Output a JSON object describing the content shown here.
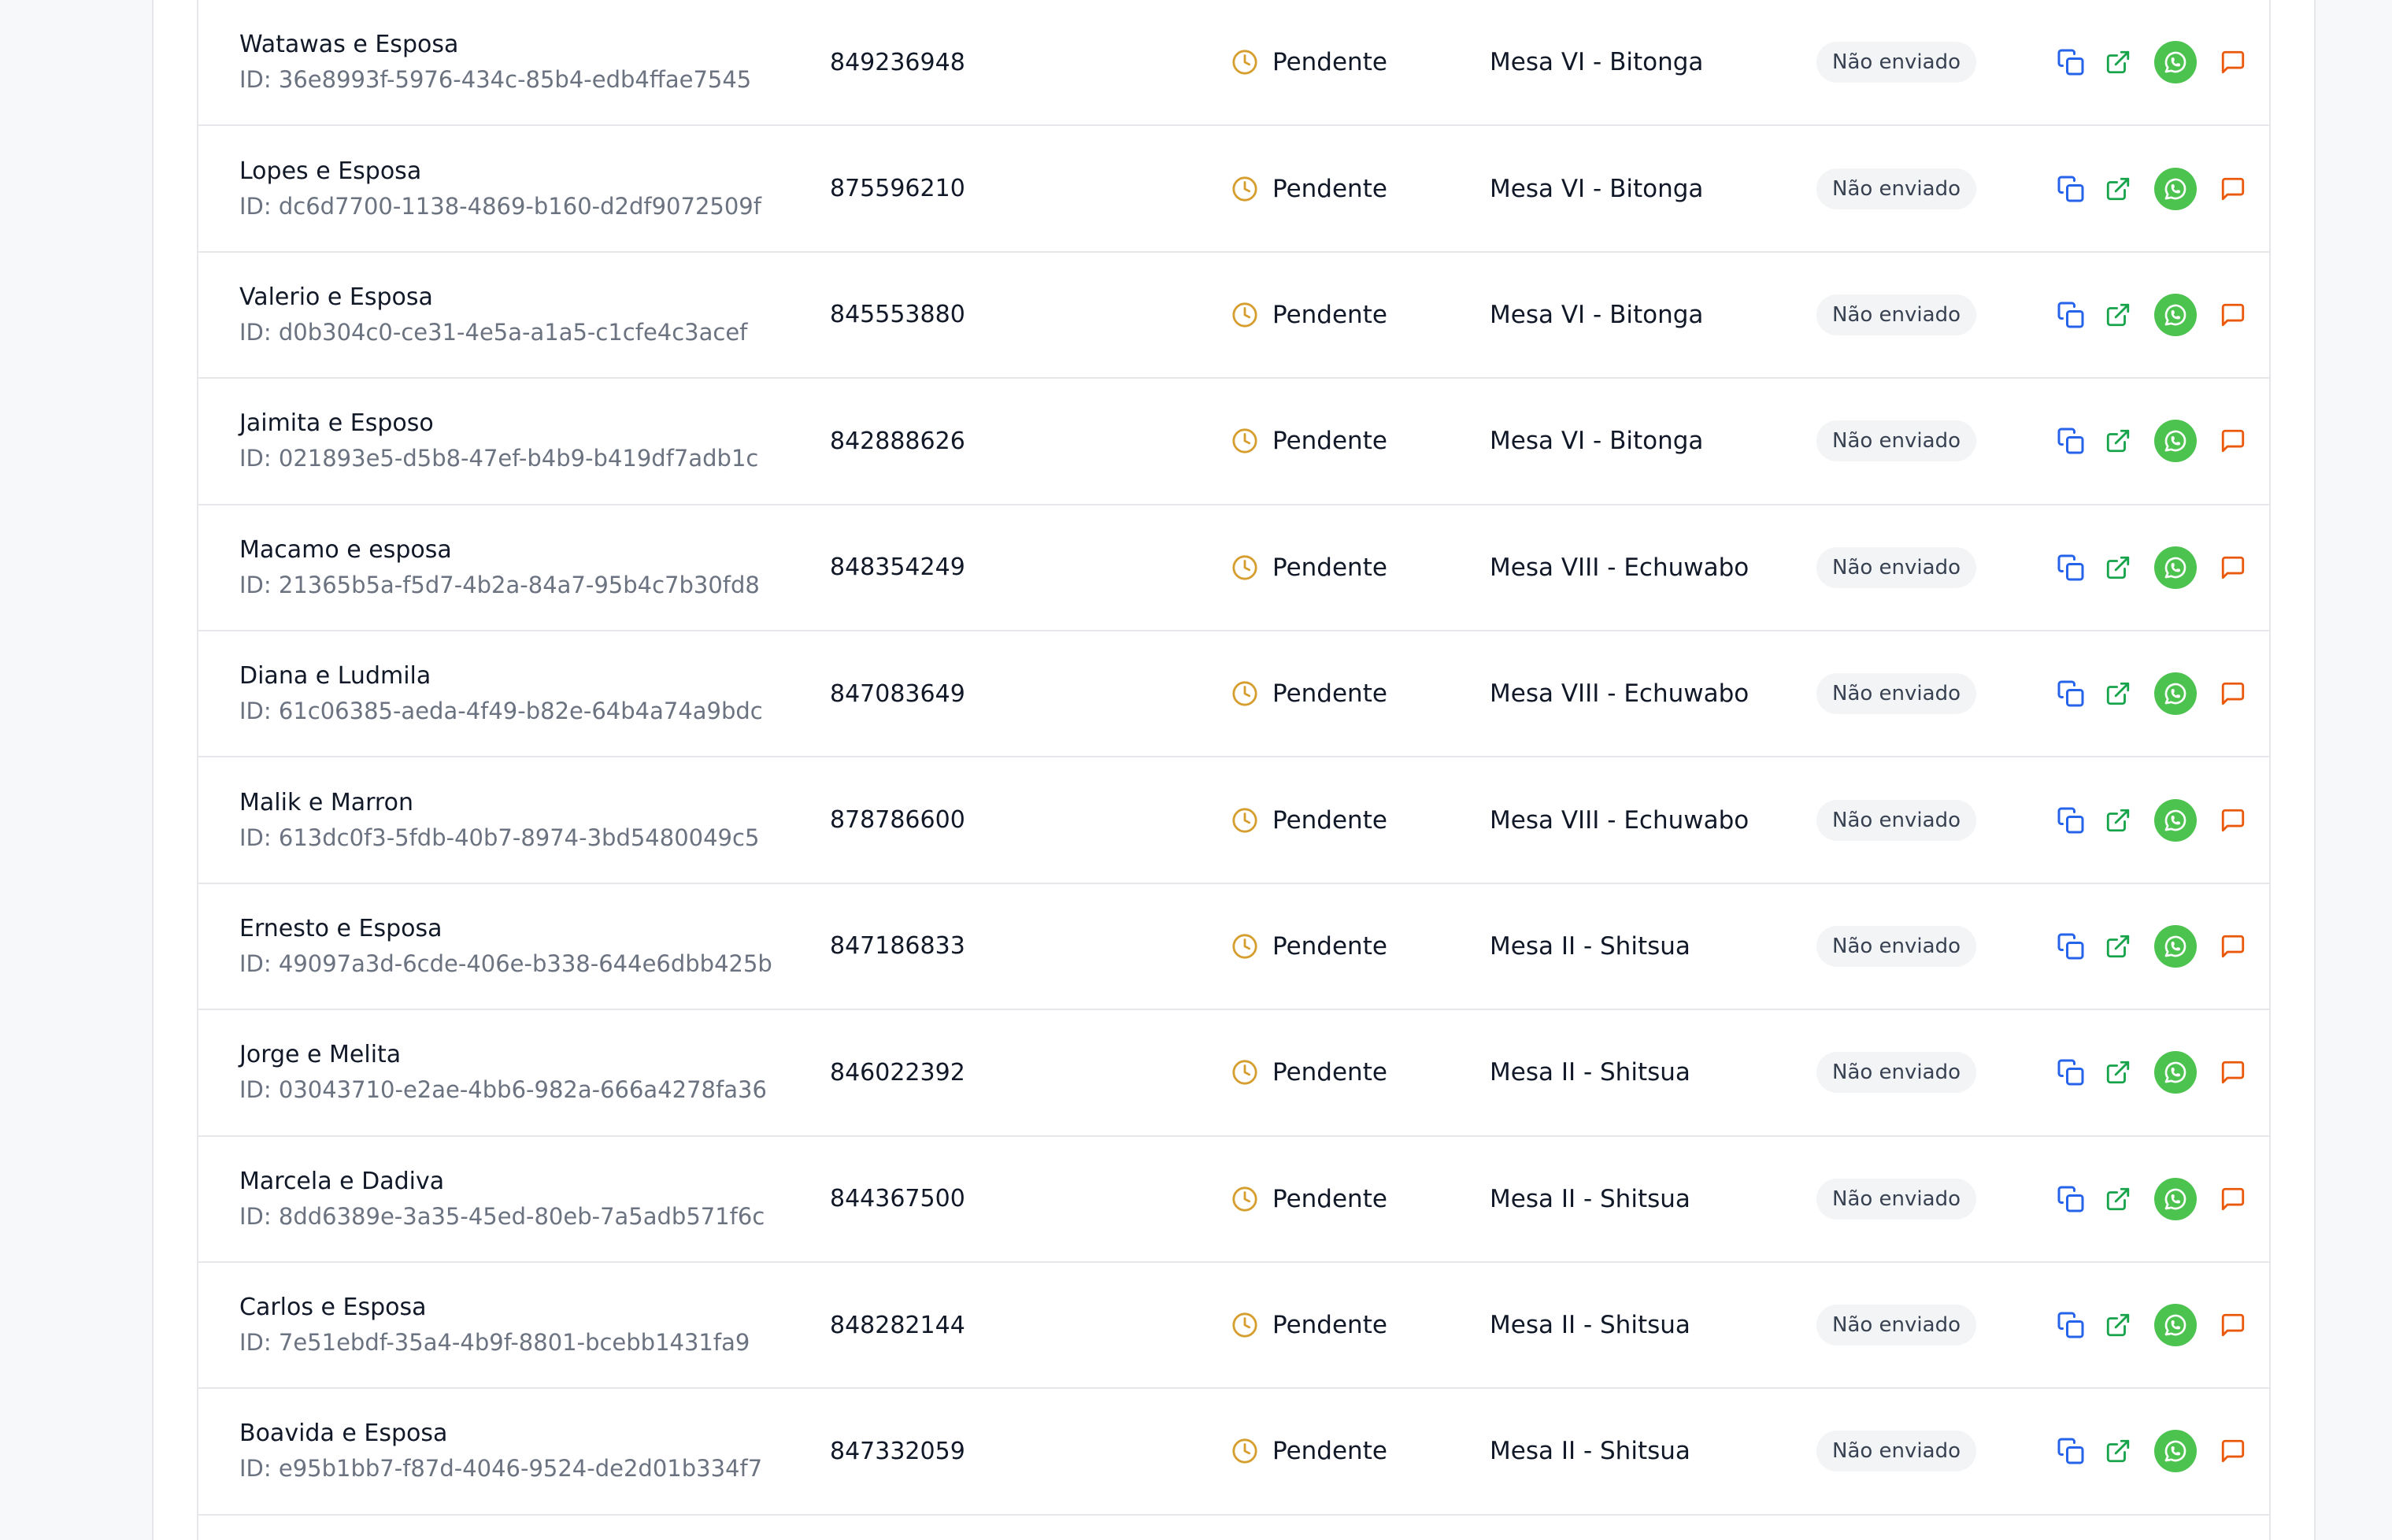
{
  "colors": {
    "status_icon": "#d69e2e",
    "copy_icon": "#2563eb",
    "open_icon": "#16a34a",
    "whatsapp_bg": "#4cc24f",
    "message_icon": "#ea580c"
  },
  "guests": [
    {
      "name": "Watawas e Esposa",
      "id": "ID: 36e8993f-5976-434c-85b4-edb4ffae7545",
      "phone": "849236948",
      "status": "Pendente",
      "table": "Mesa VI - Bitonga",
      "sent": "Não enviado"
    },
    {
      "name": "Lopes e Esposa",
      "id": "ID: dc6d7700-1138-4869-b160-d2df9072509f",
      "phone": "875596210",
      "status": "Pendente",
      "table": "Mesa VI - Bitonga",
      "sent": "Não enviado"
    },
    {
      "name": "Valerio e Esposa",
      "id": "ID: d0b304c0-ce31-4e5a-a1a5-c1cfe4c3acef",
      "phone": "845553880",
      "status": "Pendente",
      "table": "Mesa VI - Bitonga",
      "sent": "Não enviado"
    },
    {
      "name": "Jaimita e Esposo",
      "id": "ID: 021893e5-d5b8-47ef-b4b9-b419df7adb1c",
      "phone": "842888626",
      "status": "Pendente",
      "table": "Mesa VI - Bitonga",
      "sent": "Não enviado"
    },
    {
      "name": "Macamo e esposa",
      "id": "ID: 21365b5a-f5d7-4b2a-84a7-95b4c7b30fd8",
      "phone": "848354249",
      "status": "Pendente",
      "table": "Mesa VIII - Echuwabo",
      "sent": "Não enviado"
    },
    {
      "name": "Diana e Ludmila",
      "id": "ID: 61c06385-aeda-4f49-b82e-64b4a74a9bdc",
      "phone": "847083649",
      "status": "Pendente",
      "table": "Mesa VIII - Echuwabo",
      "sent": "Não enviado"
    },
    {
      "name": "Malik e Marron",
      "id": "ID: 613dc0f3-5fdb-40b7-8974-3bd5480049c5",
      "phone": "878786600",
      "status": "Pendente",
      "table": "Mesa VIII - Echuwabo",
      "sent": "Não enviado"
    },
    {
      "name": "Ernesto e Esposa",
      "id": "ID: 49097a3d-6cde-406e-b338-644e6dbb425b",
      "phone": "847186833",
      "status": "Pendente",
      "table": "Mesa II - Shitsua",
      "sent": "Não enviado"
    },
    {
      "name": "Jorge e Melita",
      "id": "ID: 03043710-e2ae-4bb6-982a-666a4278fa36",
      "phone": "846022392",
      "status": "Pendente",
      "table": "Mesa II - Shitsua",
      "sent": "Não enviado"
    },
    {
      "name": "Marcela e Dadiva",
      "id": "ID: 8dd6389e-3a35-45ed-80eb-7a5adb571f6c",
      "phone": "844367500",
      "status": "Pendente",
      "table": "Mesa II - Shitsua",
      "sent": "Não enviado"
    },
    {
      "name": "Carlos e Esposa",
      "id": "ID: 7e51ebdf-35a4-4b9f-8801-bcebb1431fa9",
      "phone": "848282144",
      "status": "Pendente",
      "table": "Mesa II - Shitsua",
      "sent": "Não enviado"
    },
    {
      "name": "Boavida e Esposa",
      "id": "ID: e95b1bb7-f87d-4046-9524-de2d01b334f7",
      "phone": "847332059",
      "status": "Pendente",
      "table": "Mesa II - Shitsua",
      "sent": "Não enviado"
    }
  ]
}
